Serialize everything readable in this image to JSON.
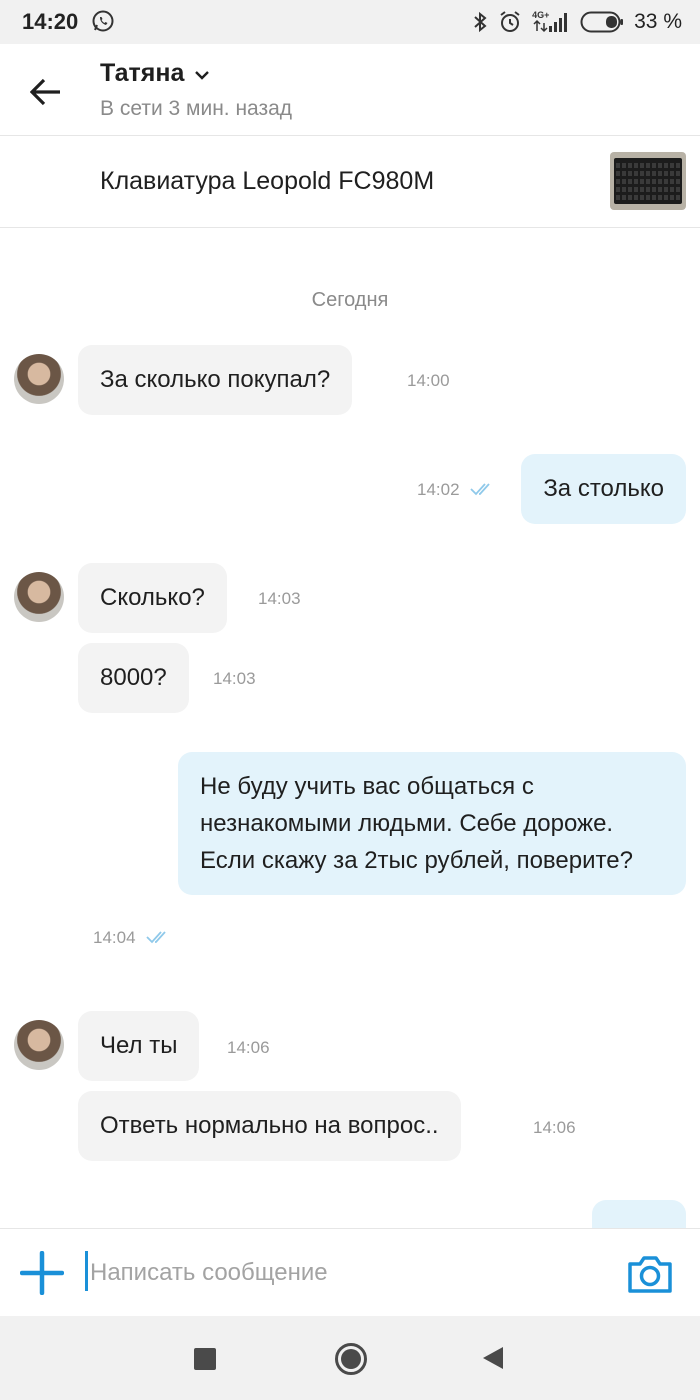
{
  "status_bar": {
    "time": "14:20",
    "network": "4G+",
    "battery": "33 %"
  },
  "header": {
    "contact_name": "Татяна",
    "contact_status": "В сети 3 мин. назад"
  },
  "listing": {
    "title": "Клавиатура Leopold FC980M"
  },
  "chat": {
    "date_separator": "Сегодня",
    "messages": [
      {
        "direction": "in",
        "text": "За сколько покупал?",
        "time": "14:00"
      },
      {
        "direction": "out",
        "text": "За столько",
        "time": "14:02",
        "read": true
      },
      {
        "direction": "in",
        "text": "Сколько?",
        "time": "14:03"
      },
      {
        "direction": "in",
        "text": "8000?",
        "time": "14:03"
      },
      {
        "direction": "out",
        "text": "Не буду учить вас общаться с незнакомыми людьми. Себе дороже.\nЕсли скажу за 2тыс рублей, поверите?",
        "time": "14:04",
        "read": true
      },
      {
        "direction": "in",
        "text": "Чел ты",
        "time": "14:06"
      },
      {
        "direction": "in",
        "text": "Ответь нормально на вопрос..",
        "time": "14:06"
      }
    ]
  },
  "input": {
    "placeholder": "Написать сообщение",
    "value": ""
  },
  "colors": {
    "accent": "#1a90d8",
    "incoming_bubble": "#f3f3f3",
    "outgoing_bubble": "#e3f3fb",
    "read_ticks": "#8fc9ea"
  }
}
